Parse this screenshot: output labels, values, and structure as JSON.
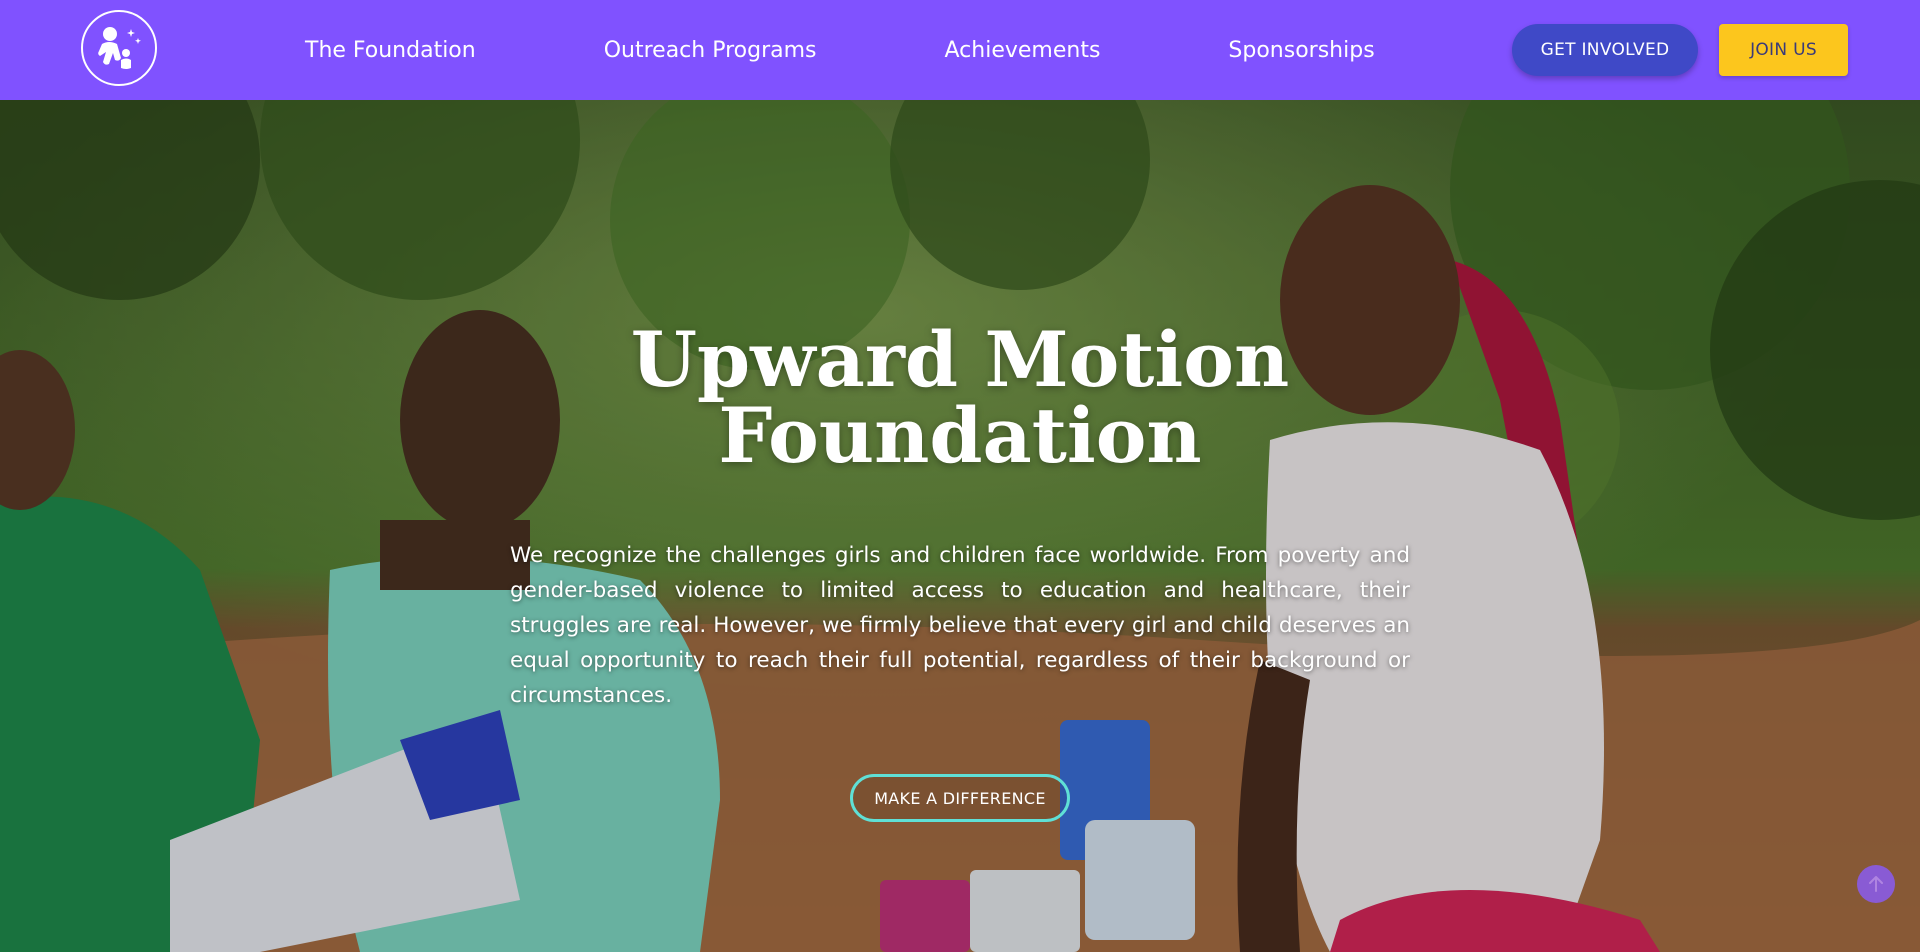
{
  "nav": {
    "logo_icon": "foundation-logo-icon",
    "links": [
      "The Foundation",
      "Outreach Programs",
      "Achievements",
      "Sponsorships"
    ],
    "get_involved_label": "GET INVOLVED",
    "join_label": "JOIN US"
  },
  "hero": {
    "title_line1": "Upward Motion",
    "title_line2": "Foundation",
    "description": "We recognize the challenges girls and children face worldwide. From poverty and gender-based violence to limited access to education and healthcare, their struggles are real. However, we firmly believe that every girl and child deserves an equal opportunity to reach their full potential, regardless of their background or circumstances.",
    "cta_label": "MAKE A DIFFERENCE",
    "scroll_icon": "arrow-up-icon"
  },
  "colors": {
    "header_bg": "#8052ff",
    "get_involved_bg": "#3f49c7",
    "join_bg": "#fcc61d",
    "cta_border": "#5fe0d6",
    "scroll_btn": "#8a5cf0"
  }
}
